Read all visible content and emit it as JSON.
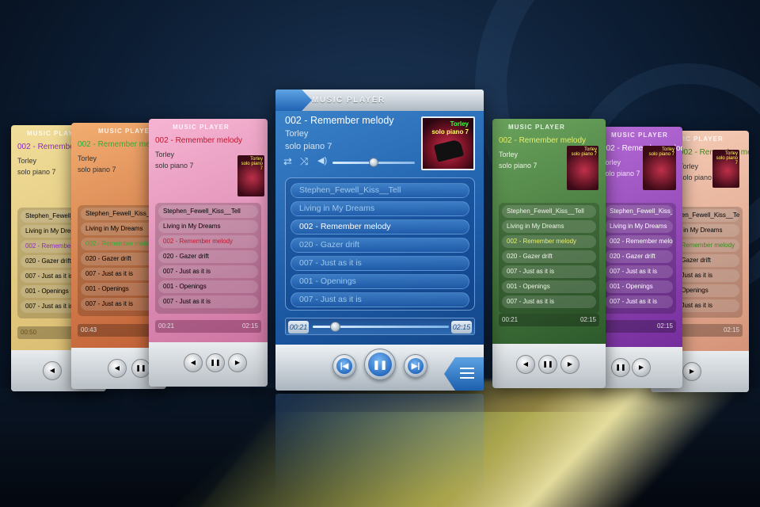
{
  "main_player": {
    "title": "MUSIC PLAYER",
    "current_track": "002 - Remember melody",
    "artist": "Torley",
    "album": "solo piano 7",
    "cover_artist": "Torley",
    "cover_album": "solo piano 7",
    "volume_level": 0.5,
    "playlist": [
      {
        "label": "Stephen_Fewell_Kiss__Tell",
        "active": false
      },
      {
        "label": "Living in My Dreams",
        "active": false
      },
      {
        "label": "002 - Remember melody",
        "active": true
      },
      {
        "label": "020 - Gazer drift",
        "active": false
      },
      {
        "label": "007 - Just as it is",
        "active": false
      },
      {
        "label": "001 - Openings",
        "active": false
      },
      {
        "label": "007 - Just as it is",
        "active": false
      }
    ],
    "time_elapsed": "00:21",
    "time_total": "02:15",
    "progress": 0.16,
    "icons": {
      "repeat": "repeat-icon",
      "shuffle": "shuffle-icon",
      "volume": "volume-icon",
      "prev": "previous-icon",
      "play_pause": "pause-icon",
      "next": "next-icon",
      "menu": "menu-icon"
    },
    "colors": {
      "accent": "#2a6ec2",
      "text_active": "#ffffff",
      "text_inactive": "#9cc8ee"
    }
  },
  "side_panels": [
    {
      "theme": "pink",
      "title": "MUSIC PLAYER",
      "track": "002 - Remember melody",
      "artist": "Torley",
      "album": "solo piano 7",
      "cover_artist": "Torley",
      "cover_album": "solo piano 7",
      "playlist": [
        "Stephen_Fewell_Kiss__Tell",
        "Living in My Dreams",
        "002 - Remember melody",
        "020 - Gazer drift",
        "007 - Just as it is",
        "001 - Openings",
        "007 - Just as it is"
      ],
      "time_elapsed": "00:21",
      "time_total": "02:15",
      "colors": {
        "base": "#c66a9a",
        "track": "#c2162e"
      }
    },
    {
      "theme": "orange",
      "title": "MUSIC PLAYER",
      "track": "002 - Remember melody",
      "artist": "Torley",
      "album": "solo piano 7",
      "playlist": [
        "Stephen_Fewell_Kiss__Tell",
        "Living in My Dreams",
        "002 - Remember melody",
        "020 - Gazer drift",
        "007 - Just as it is",
        "001 - Openings",
        "007 - Just as it is"
      ],
      "time_elapsed": "00:43",
      "colors": {
        "base": "#d88a4e",
        "track": "#2fae3a"
      }
    },
    {
      "theme": "yellow",
      "title": "MUSIC PLAYER",
      "track": "002 - Remember melody",
      "artist": "Torley",
      "album": "solo piano 7",
      "playlist": [
        "Stephen_Fewell_Kiss__Tell",
        "Living in My Dreams",
        "002 - Remember melody",
        "020 - Gazer drift",
        "007 - Just as it is",
        "001 - Openings",
        "007 - Just as it is"
      ],
      "time_elapsed": "00:50",
      "colors": {
        "base": "#dcc27a",
        "track": "#8e2bbf"
      }
    },
    {
      "theme": "green",
      "title": "MUSIC PLAYER",
      "track": "002 - Remember melody",
      "artist": "Torley",
      "album": "solo piano 7",
      "cover_artist": "Torley",
      "cover_album": "solo piano 7",
      "playlist": [
        "Stephen_Fewell_Kiss__Tell",
        "Living in My Dreams",
        "002 - Remember melody",
        "020 - Gazer drift",
        "007 - Just as it is",
        "001 - Openings",
        "007 - Just as it is"
      ],
      "time_elapsed": "00:21",
      "time_total": "02:15",
      "colors": {
        "base": "#3f7a3c",
        "track": "#e7f06a"
      }
    },
    {
      "theme": "purple",
      "title": "MUSIC PLAYER",
      "track": "002 - Remember melody",
      "artist": "Torley",
      "album": "solo piano 7",
      "cover_artist": "Torley",
      "cover_album": "solo piano 7",
      "playlist": [
        "Stephen_Fewell_Kiss__Tell",
        "Living in My Dreams",
        "002 - Remember melody",
        "020 - Gazer drift",
        "007 - Just as it is",
        "001 - Openings",
        "007 - Just as it is"
      ],
      "time_total": "02:15",
      "colors": {
        "base": "#8a3fb0",
        "track": "#ffffff"
      }
    },
    {
      "theme": "peach",
      "title": "MUSIC PLAYER",
      "track": "002 - Remember melody",
      "artist": "Torley",
      "album": "solo piano 7",
      "cover_artist": "Torley",
      "cover_album": "solo piano 7",
      "playlist": [
        "Stephen_Fewell_Kiss__Tell",
        "Living in My Dreams",
        "002 - Remember melody",
        "020 - Gazer drift",
        "007 - Just as it is",
        "001 - Openings",
        "007 - Just as it is"
      ],
      "time_total": "02:15",
      "colors": {
        "base": "#e6a58e",
        "track": "#3c8a1e"
      }
    }
  ]
}
